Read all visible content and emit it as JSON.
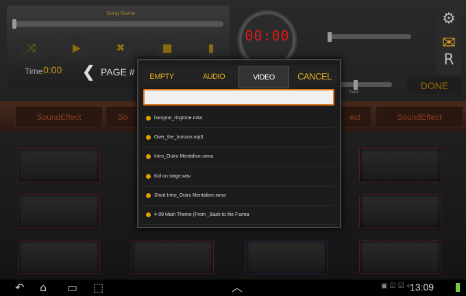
{
  "player": {
    "song_name": "Song Name",
    "time_label": "Time",
    "time_value": "0:00",
    "page_label": "PAGE #",
    "controls": [
      {
        "name": "shuffle-button",
        "icon": "⤨"
      },
      {
        "name": "play-button",
        "icon": "▶"
      },
      {
        "name": "stop-x-button",
        "icon": "✖"
      },
      {
        "name": "stop-button",
        "icon": "■"
      },
      {
        "name": "waveform-button",
        "icon": "▮"
      }
    ]
  },
  "clock": {
    "digits": "00:00"
  },
  "right_panel": {
    "fade_label": "Fade",
    "done_label": "DONE",
    "r_label": "R",
    "gear_icon": "⚙",
    "mail_icon": "✉"
  },
  "fx_row": [
    {
      "label": "SoundEffect"
    },
    {
      "label": "So"
    },
    {
      "label": "ect"
    },
    {
      "label": "SoundEffect"
    }
  ],
  "dialog": {
    "tabs": {
      "empty": "EMPTY TRACKS",
      "audio": "AUDIO LIBRARY",
      "video": "VIDEO LIBRARY",
      "cancel": "CANCEL"
    },
    "search_value": "",
    "items": [
      "hangout_ringtone.m4a",
      "Over_the_horizon.mp3",
      "Intro_Outro Mentalism.wma",
      "Kid on stage.wav",
      "Short Intro_Outro Mentalism.wma",
      "4-09 Main Theme (From _Back to the F.wma"
    ]
  },
  "navbar": {
    "time": "13:09",
    "back_icon": "↶",
    "home_icon": "⌂",
    "recent_icon": "▭",
    "screenshot_icon": "⬚",
    "up_icon": "︿"
  },
  "colors": {
    "accent": "#e0b020",
    "clock_red": "#e01818",
    "pad_border": "#5a1a1a"
  }
}
